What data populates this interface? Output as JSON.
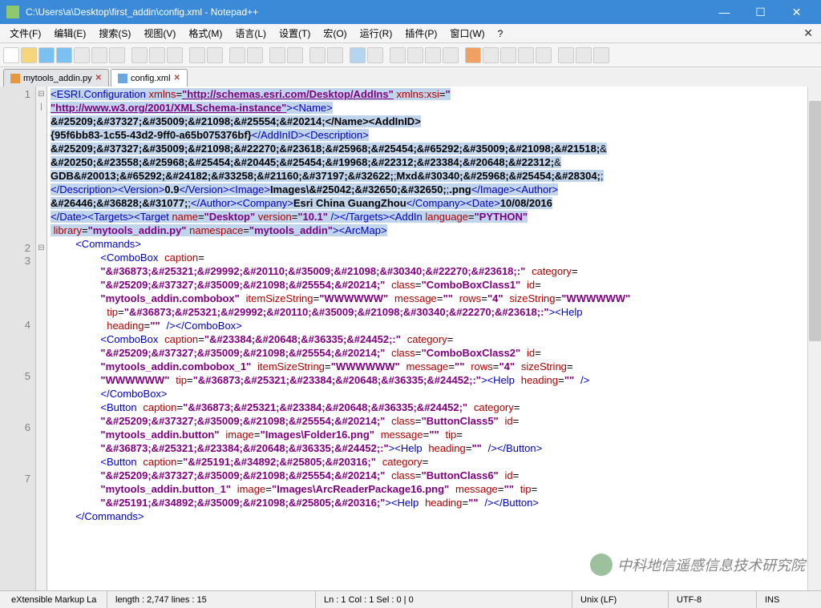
{
  "title": "C:\\Users\\a\\Desktop\\first_addin\\config.xml - Notepad++",
  "menu": [
    "文件(F)",
    "编辑(E)",
    "搜索(S)",
    "视图(V)",
    "格式(M)",
    "语言(L)",
    "设置(T)",
    "宏(O)",
    "运行(R)",
    "插件(P)",
    "窗口(W)",
    "?"
  ],
  "tabs": [
    {
      "name": "mytools_addin.py",
      "active": false
    },
    {
      "name": "config.xml",
      "active": true
    }
  ],
  "lines": {
    "l1a": "<ESRI.Configuration",
    "l1b": "xmlns",
    "l1c": "\"http://schemas.esri.com/Desktop/AddIns\"",
    "l1d": "xmlns:xsi",
    "l2a": "\"http://www.w3.org/2001/XMLSchema-instance\"",
    "l2b": "><Name>",
    "l3": "&#25209;&#37327;&#35009;&#21098;&#25554;&#20214;</Name><AddInID>",
    "l4a": "{95f6bb83-1c55-43d2-9ff0-a65b075376bf}",
    "l4b": "</AddInID><Description>",
    "l5": "&#25209;&#37327;&#35009;&#21098;&#22270;&#23618;&#25968;&#25454;&#65292;&#35009;&#21098;&#21518;",
    "l6": "&#20250;&#23558;&#25968;&#25454;&#20445;&#25454;&#19968;&#22312;&#23384;&#20648;&#22312;",
    "l7a": "GDB",
    "l7b": "&#20013;&#65292;&#24182;&#33258;&#21160;&#37197;&#32622;",
    "l7c": "Mxd",
    "l7d": "&#30340;&#25968;&#25454;&#28304;",
    "l8a": "</Description><Version>",
    "l8b": "0.9",
    "l8c": "</Version><Image>",
    "l8d": "Images\\",
    "l8e": "&#25042;&#32650;&#32650;",
    "l8f": ".png",
    "l8g": "</Image><Author>",
    "l9a": "&#26446;&#36828;&#31077;",
    "l9b": "</Author><Company>",
    "l9c": "Esri China GuangZhou",
    "l9d": "</Company><Date>",
    "l9e": "10/08/2016",
    "l10a": "</Date><Targets><Target",
    "l10b": "name",
    "l10c": "\"Desktop\"",
    "l10d": "version",
    "l10e": "\"10.1\"",
    "l10f": "/></Targets><AddIn",
    "l10g": "language",
    "l10h": "\"PYTHON\"",
    "l11a": "library",
    "l11b": "\"mytools_addin.py\"",
    "l11c": "namespace",
    "l11d": "\"mytools_addin\"",
    "l11e": "><ArcMap>",
    "cmd_open": "<Commands>",
    "cb1_a": "<ComboBox",
    "cb1_cap": "caption",
    "cb1_capv": "\"&#36873;&#25321;&#29992;&#20110;&#35009;&#21098;&#30340;&#22270;&#23618;:\"",
    "cb1_cat": "category",
    "cb1_catv": "\"&#25209;&#37327;&#35009;&#21098;&#25554;&#20214;\"",
    "cb1_cls": "class",
    "cb1_clsv": "\"ComboBoxClass1\"",
    "cb1_id": "id",
    "cb1_idv": "\"mytools_addin.combobox\"",
    "cb1_iss": "itemSizeString",
    "cb1_issv": "\"WWWWWW\"",
    "cb1_msg": "message",
    "cb1_msgv": "\"\"",
    "cb1_rows": "rows",
    "cb1_rowsv": "\"4\"",
    "cb1_ss": "sizeString",
    "cb1_ssv": "\"WWWWWW\"",
    "cb1_tip": "tip",
    "cb1_tipv": "\"&#36873;&#25321;&#29992;&#20110;&#35009;&#21098;&#30340;&#22270;&#23618;:\"",
    "cb1_help": "><Help",
    "cb1_hd": "heading",
    "cb1_hdv": "\"\"",
    "cb1_close": "/></ComboBox>",
    "cb2_capv": "\"&#23384;&#20648;&#36335;&#24452;:\"",
    "cb2_clsv": "\"ComboBoxClass2\"",
    "cb2_idv": "\"mytools_addin.combobox_1\"",
    "cb2_tipv": "\"&#36873;&#25321;&#23384;&#20648;&#36335;&#24452;:\"",
    "cb2_help2": "><Help",
    "cb2_close2": "/>",
    "cb2_end": "</ComboBox>",
    "btn1_tag": "<Button",
    "btn1_capv": "\"&#36873;&#25321;&#23384;&#20648;&#36335;&#24452;\"",
    "btn1_clsv": "\"ButtonClass5\"",
    "btn1_idv": "\"mytools_addin.button\"",
    "btn1_img": "image",
    "btn1_imgv": "\"Images\\Folder16.png\"",
    "btn1_tipv": "\"&#36873;&#25321;&#23384;&#20648;&#36335;&#24452;:\"",
    "btn1_close": "/></Button>",
    "btn2_capv": "\"&#25191;&#34892;&#25805;&#20316;\"",
    "btn2_clsv": "\"ButtonClass6\"",
    "btn2_idv": "\"mytools_addin.button_1\"",
    "btn2_imgv": "\"Images\\ArcReaderPackage16.png\"",
    "btn2_tipv": "\"&#25191;&#34892;&#35009;&#21098;&#25805;&#20316;\"",
    "cmd_close": "</Commands>"
  },
  "status": {
    "lang": "eXtensible Markup La",
    "len": "length : 2,747    lines : 15",
    "pos": "Ln : 1    Col : 1    Sel : 0 | 0",
    "eol": "Unix (LF)",
    "enc": "UTF-8",
    "ins": "INS"
  },
  "watermark": "中科地信遥感信息技术研究院"
}
